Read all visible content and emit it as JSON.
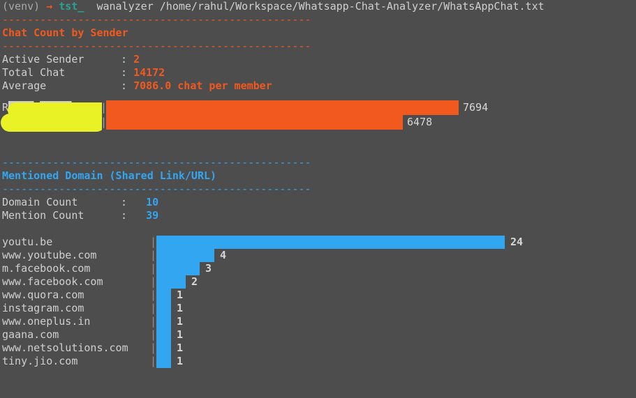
{
  "terminal": {
    "background_color": "#4d4d4d",
    "foreground_color": "#cfd0ce",
    "accent_orange": "#f2591e",
    "accent_blue": "#33a6f2",
    "prompt": {
      "venv": "(venv)",
      "arrow": "→",
      "host": "tst_",
      "command": "wanalyzer /home/rahul/Workspace/Whatsapp-Chat-Analyzer/WhatsAppChat.txt"
    },
    "rules": {
      "orange": "-------------------------------------------------",
      "blue": "-------------------------------------------------"
    },
    "sections": [
      {
        "heading": "Chat Count by Sender",
        "color": "#f2591e",
        "stats": [
          {
            "label": "Active Sender",
            "colon": ":",
            "value": "2"
          },
          {
            "label": "Total Chat",
            "colon": ":",
            "value": "14172"
          },
          {
            "label": "Average",
            "colon": ":",
            "value": "7086.0 chat per member"
          }
        ]
      },
      {
        "heading": "Mentioned Domain (Shared Link/URL)",
        "color": "#33a6f2",
        "stats": [
          {
            "label": "Domain Count",
            "colon": ":",
            "value": "10"
          },
          {
            "label": "Mention Count",
            "colon": ":",
            "value": "39"
          }
        ]
      }
    ],
    "redaction": {
      "kind": "yellow-highlighter-scribble",
      "color": "#e8f224",
      "covers": "sender names in chat-count bar chart"
    }
  },
  "chart_data": [
    {
      "type": "bar",
      "orientation": "horizontal",
      "title": "Chat Count by Sender",
      "xlabel": "",
      "ylabel": "",
      "color": "#f2591e",
      "grid": false,
      "legend": null,
      "xlim": [
        0,
        7694
      ],
      "categories": [
        "R████ █████",
        "A██████████"
      ],
      "categories_note": "both sender labels obscured by yellow highlighter redaction",
      "values": [
        7694,
        6478
      ],
      "value_labels": [
        "7694",
        "6478"
      ]
    },
    {
      "type": "bar",
      "orientation": "horizontal",
      "title": "Mentioned Domain (Shared Link/URL)",
      "xlabel": "",
      "ylabel": "",
      "color": "#33a6f2",
      "grid": false,
      "legend": null,
      "xlim": [
        0,
        24
      ],
      "categories": [
        "youtu.be",
        "www.youtube.com",
        "m.facebook.com",
        "www.facebook.com",
        "www.quora.com",
        "instagram.com",
        "www.oneplus.in",
        "gaana.com",
        "www.netsolutions.com",
        "tiny.jio.com"
      ],
      "values": [
        24,
        4,
        3,
        2,
        1,
        1,
        1,
        1,
        1,
        1
      ],
      "value_labels": [
        "24",
        "4",
        "3",
        "2",
        "1",
        "1",
        "1",
        "1",
        "1",
        "1"
      ]
    }
  ]
}
